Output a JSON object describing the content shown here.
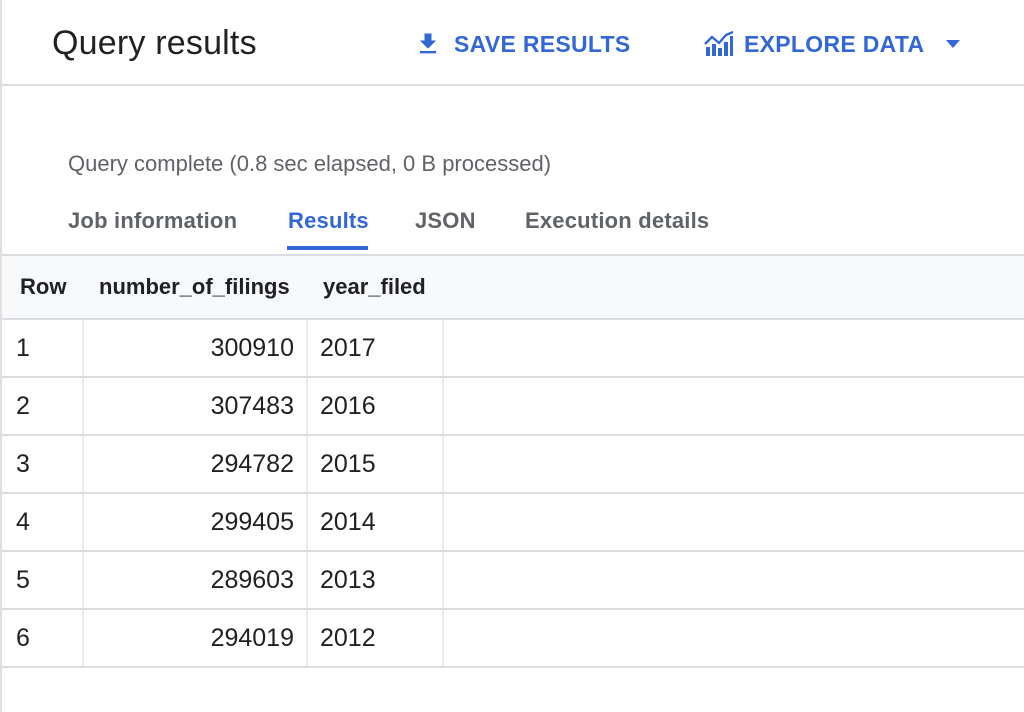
{
  "header": {
    "title": "Query results",
    "save_results_label": "SAVE RESULTS",
    "explore_data_label": "EXPLORE DATA"
  },
  "status": "Query complete (0.8 sec elapsed, 0 B processed)",
  "tabs": [
    {
      "label": "Job information",
      "active": false
    },
    {
      "label": "Results",
      "active": true
    },
    {
      "label": "JSON",
      "active": false
    },
    {
      "label": "Execution details",
      "active": false
    }
  ],
  "table": {
    "columns": [
      "Row",
      "number_of_filings",
      "year_filed"
    ],
    "rows": [
      {
        "row": "1",
        "number_of_filings": "300910",
        "year_filed": "2017"
      },
      {
        "row": "2",
        "number_of_filings": "307483",
        "year_filed": "2016"
      },
      {
        "row": "3",
        "number_of_filings": "294782",
        "year_filed": "2015"
      },
      {
        "row": "4",
        "number_of_filings": "299405",
        "year_filed": "2014"
      },
      {
        "row": "5",
        "number_of_filings": "289603",
        "year_filed": "2013"
      },
      {
        "row": "6",
        "number_of_filings": "294019",
        "year_filed": "2012"
      }
    ]
  },
  "colors": {
    "accent": "#3367d6",
    "text": "#202124",
    "muted": "#5f6368",
    "divider": "#dadce0"
  },
  "icons": {
    "save": "download-icon",
    "explore": "chart-icon",
    "dropdown": "caret-down-icon"
  }
}
